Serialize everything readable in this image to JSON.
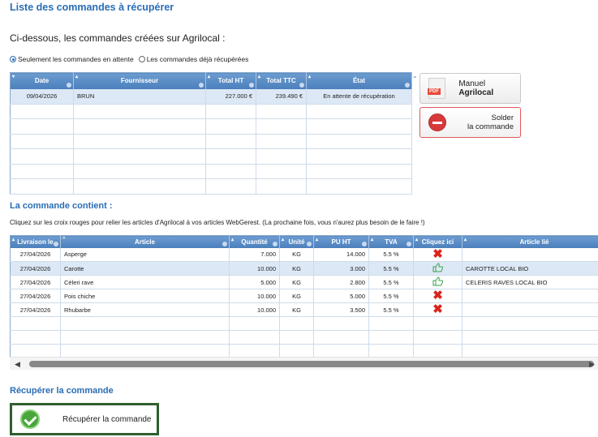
{
  "page": {
    "title": "Liste des commandes à récupérer",
    "intro": "Ci-dessous, les commandes créées sur Agrilocal :"
  },
  "filters": {
    "option_pending": "Seulement les commandes en attente",
    "option_done": "Les commandes déjà récupérées",
    "selected": "option_pending"
  },
  "orders_table": {
    "columns": [
      "Date",
      "Fournisseur",
      "Total HT",
      "Total TTC",
      "État"
    ],
    "rows": [
      {
        "date": "09/04/2026",
        "supplier": "BRUN",
        "total_ht": "227.000 €",
        "total_ttc": "239.490 €",
        "state": "En attente de récupération"
      }
    ]
  },
  "buttons": {
    "manual_prefix": "Manuel ",
    "manual_bold": "Agrilocal",
    "pdf_badge": "PDF",
    "solder_line1": "Solder",
    "solder_line2": "la commande",
    "recuperer": "Récupérer la commande"
  },
  "section_contents": {
    "title": "La commande contient :",
    "hint": "Cliquez sur les croix rouges pour relier les articles d'Agrilocal à vos articles WebGerest. (La prochaine fois, vous n'aurez plus besoin de le faire !)"
  },
  "articles_table": {
    "columns": [
      "Livraison le",
      "Article",
      "Quantité",
      "Unité",
      "PU HT",
      "TVA",
      "Cliquez ici",
      "Article lié"
    ],
    "rows": [
      {
        "date": "27/04/2026",
        "article": "Asperge",
        "qty": "7.000",
        "unit": "KG",
        "pu": "14.000",
        "tva": "5.5 %",
        "action": "red-x",
        "linked": ""
      },
      {
        "date": "27/04/2026",
        "article": "Carotte",
        "qty": "10.000",
        "unit": "KG",
        "pu": "3.000",
        "tva": "5.5 %",
        "action": "thumb-up",
        "linked": "CAROTTE LOCAL BIO"
      },
      {
        "date": "27/04/2026",
        "article": "Céleri rave",
        "qty": "5.000",
        "unit": "KG",
        "pu": "2.800",
        "tva": "5.5 %",
        "action": "thumb-up",
        "linked": "CELERIS RAVES LOCAL BIO"
      },
      {
        "date": "27/04/2026",
        "article": "Pois chiche",
        "qty": "10.000",
        "unit": "KG",
        "pu": "5.000",
        "tva": "5.5 %",
        "action": "red-x",
        "linked": ""
      },
      {
        "date": "27/04/2026",
        "article": "Rhubarbe",
        "qty": "10.000",
        "unit": "KG",
        "pu": "3.500",
        "tva": "5.5 %",
        "action": "red-x",
        "linked": ""
      }
    ]
  },
  "section_recover": {
    "title": "Récupérer la commande"
  },
  "colors": {
    "accent": "#2a6db5",
    "header": "#5a8cc6",
    "danger": "#d9251d",
    "success": "#4aa53a"
  }
}
